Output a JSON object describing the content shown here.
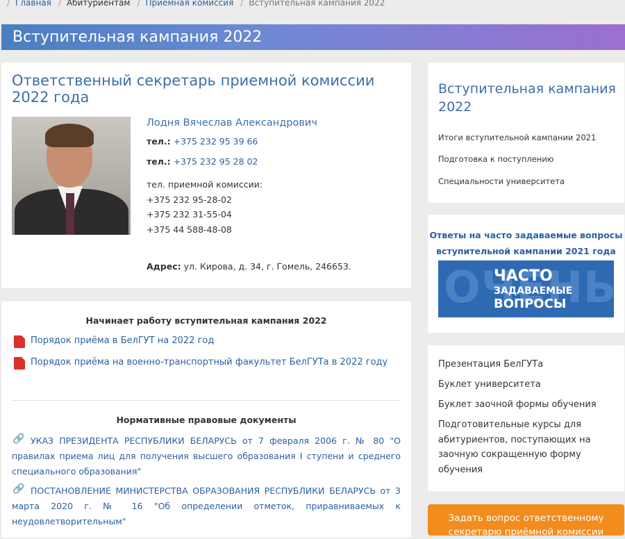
{
  "breadcrumb": {
    "items": [
      "Главная",
      "Абитуриентам",
      "Приемная комиссия",
      "Вступительная кампания 2022"
    ]
  },
  "banner": {
    "title": "Вступительная кампания 2022"
  },
  "secretary": {
    "heading_line1": "Ответственный секретарь приемной комиссии",
    "heading_line2": "2022 года",
    "name": "Лодня Вячеслав Александрович",
    "tel_label": "тел.:",
    "tel1": "+375 232 95 39 66",
    "tel2": "+375 232 95 28 02",
    "commission_label": "тел. приемной комиссии:",
    "commission_phones": [
      "+375 232 95-28-02",
      "+375 232 31-55-04",
      "+375 44 588-48-08"
    ],
    "address_label": "Адрес:",
    "address_value": "ул. Кирова, д. 34, г. Гомель, 246653."
  },
  "campaign": {
    "heading": "Начинает работу вступительная кампания 2022",
    "docs": [
      "Порядок приёма в БелГУТ на 2022 год",
      "Порядок приёма на военно-транспортный факультет БелГУТа в 2022 году"
    ],
    "legal_heading": "Нормативные правовые документы",
    "legal": [
      {
        "lines": [
          "УКАЗ ПРЕЗИДЕНТА РЕСПУБЛИКИ БЕЛАРУСЬ от 7 февраля 2006 г. № 80 \"О",
          "правилах приема лиц для получения высшего образования I ступени и среднего",
          "специального образования\""
        ]
      },
      {
        "lines": [
          "ПОСТАНОВЛЕНИЕ МИНИСТЕРСТВА ОБРАЗОВАНИЯ РЕСПУБЛИКИ БЕЛАРУСЬ от 3",
          "марта 2020 г. № 16 \"Об определении отметок, приравниваемых к",
          "неудовлетворительным\""
        ]
      }
    ]
  },
  "sidebar": {
    "heading_line1": "Вступительная кампания",
    "heading_line2": "2022",
    "links": [
      "Итоги вступительной кампании 2021",
      "Подготовка к поступлению",
      "Специальности университета"
    ],
    "faq_line1": "Ответы на часто задаваемые вопросы",
    "faq_line2": "вступительной кампании 2021 года",
    "faq_banner": {
      "bg": "ОЧЕНЬ",
      "line1": "ЧАСТО",
      "line2": "ЗАДАВАЕМЫЕ",
      "line3": "ВОПРОСЫ"
    },
    "resources": [
      "Презентация БелГУТа",
      "Буклет университета",
      "Буклет заочной формы обучения"
    ],
    "courses_lines": [
      "Подготовительные курсы для",
      "абитуриентов, поступающих на",
      "заочную сокращенную форму",
      "обучения"
    ],
    "ask_line1": "Задать вопрос ответственному",
    "ask_line2": "секретарю приёмной комиссии"
  }
}
